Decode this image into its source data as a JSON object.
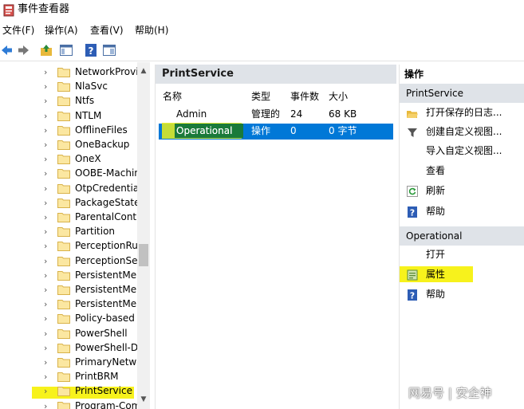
{
  "window": {
    "title": "事件查看器"
  },
  "menubar": {
    "items": [
      "文件(F)",
      "操作(A)",
      "查看(V)",
      "帮助(H)"
    ]
  },
  "toolbar": {
    "icons": [
      "back-arrow-icon",
      "forward-arrow-icon",
      "up-folder-icon",
      "show-hide-tree-icon",
      "help-icon",
      "show-hide-action-pane-icon"
    ]
  },
  "tree": {
    "items": [
      {
        "label": "NetworkProvis"
      },
      {
        "label": "NlaSvc"
      },
      {
        "label": "Ntfs"
      },
      {
        "label": "NTLM"
      },
      {
        "label": "OfflineFiles"
      },
      {
        "label": "OneBackup"
      },
      {
        "label": "OneX"
      },
      {
        "label": "OOBE-Machin"
      },
      {
        "label": "OtpCredentialI"
      },
      {
        "label": "PackageStateR"
      },
      {
        "label": "ParentalContro"
      },
      {
        "label": "Partition"
      },
      {
        "label": "PerceptionRur"
      },
      {
        "label": "PerceptionSen"
      },
      {
        "label": "PersistentMem"
      },
      {
        "label": "PersistentMem"
      },
      {
        "label": "PersistentMem"
      },
      {
        "label": "Policy-based C"
      },
      {
        "label": "PowerShell"
      },
      {
        "label": "PowerShell-De"
      },
      {
        "label": "PrimaryNetwo"
      },
      {
        "label": "PrintBRM"
      },
      {
        "label": "PrintService",
        "highlighted": true
      },
      {
        "label": "Program-Com"
      }
    ]
  },
  "middle": {
    "title": "PrintService",
    "columns": [
      "名称",
      "类型",
      "事件数",
      "大小"
    ],
    "rows": [
      {
        "name": "Admin",
        "type": "管理的",
        "count": "24",
        "size": "68 KB",
        "selected": false
      },
      {
        "name": "Operational",
        "type": "操作",
        "count": "0",
        "size": "0 字节",
        "selected": true
      }
    ]
  },
  "actions": {
    "header": "操作",
    "section1": {
      "title": "PrintService",
      "items": [
        {
          "label": "打开保存的日志...",
          "icon": "open-folder-icon"
        },
        {
          "label": "创建自定义视图...",
          "icon": "filter-icon"
        },
        {
          "label": "导入自定义视图...",
          "icon": ""
        },
        {
          "label": "查看",
          "icon": ""
        },
        {
          "label": "刷新",
          "icon": "refresh-icon"
        },
        {
          "label": "帮助",
          "icon": "help-icon"
        }
      ]
    },
    "section2": {
      "title": "Operational",
      "items": [
        {
          "label": "打开",
          "icon": ""
        },
        {
          "label": "属性",
          "icon": "properties-icon",
          "highlighted": true
        },
        {
          "label": "帮助",
          "icon": "help-icon"
        }
      ]
    }
  },
  "watermark": "网易号 | 安企神",
  "colors": {
    "selection": "#0078d7",
    "highlight": "#f7f21c",
    "pane_header": "#dfe3e8"
  }
}
